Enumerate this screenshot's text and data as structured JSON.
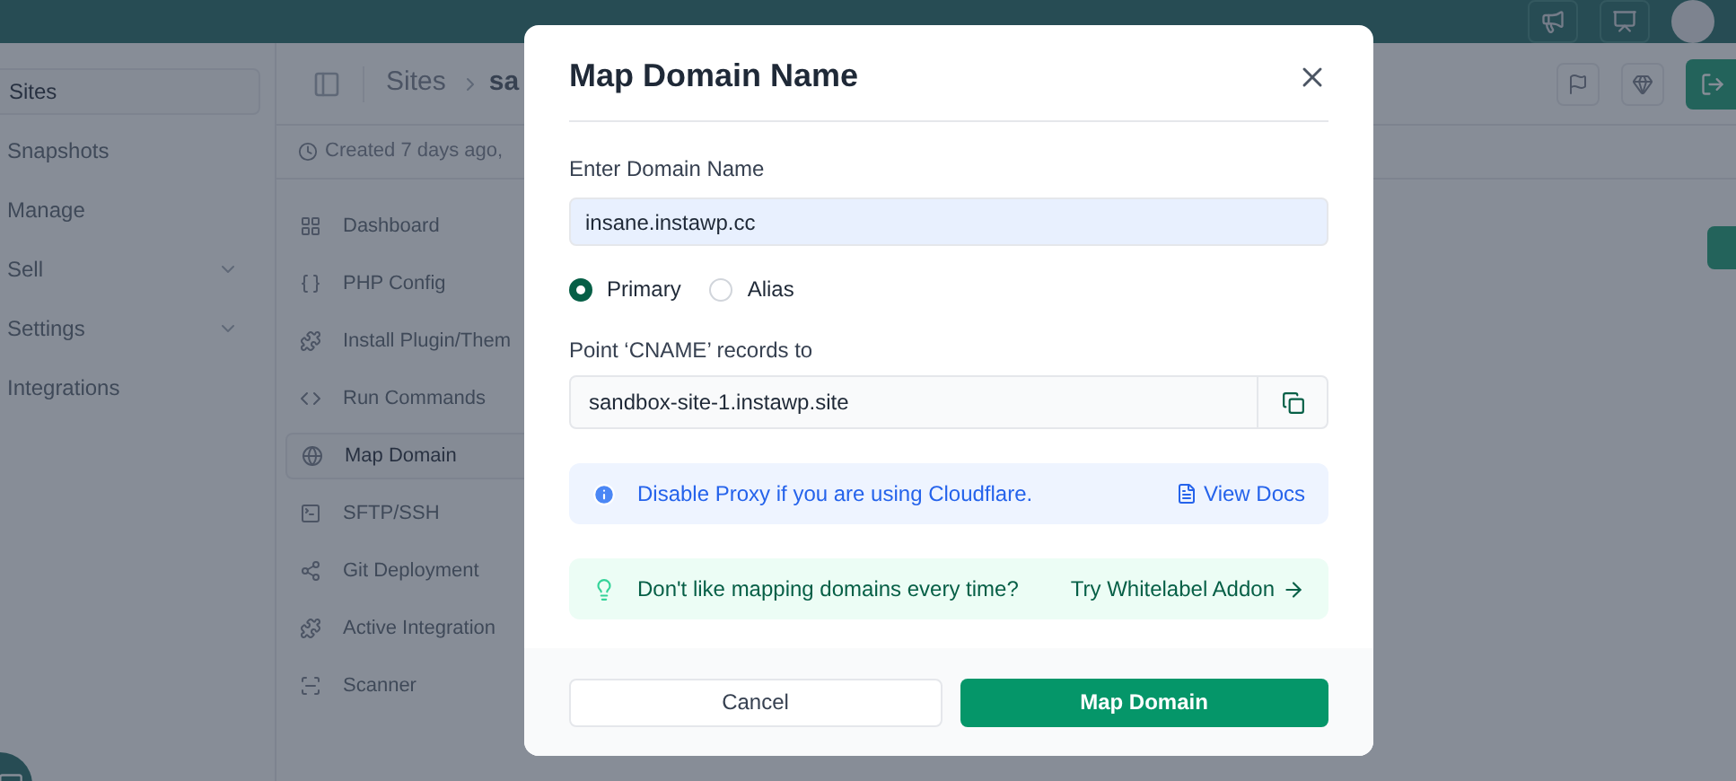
{
  "sidebar": {
    "items": [
      {
        "label": "Sites",
        "selected": true,
        "kind": "link"
      },
      {
        "label": "Snapshots",
        "selected": false,
        "kind": "link"
      },
      {
        "label": "Manage",
        "selected": false,
        "kind": "link"
      },
      {
        "label": "Sell",
        "selected": false,
        "kind": "group"
      },
      {
        "label": "Settings",
        "selected": false,
        "kind": "group"
      },
      {
        "label": "Integrations",
        "selected": false,
        "kind": "link"
      }
    ]
  },
  "header": {
    "breadcrumb": [
      "Sites",
      "sa"
    ]
  },
  "site_info": {
    "created": "Created 7 days ago,"
  },
  "site_nav": {
    "items": [
      {
        "label": "Dashboard",
        "selected": false
      },
      {
        "label": "PHP Config",
        "selected": false
      },
      {
        "label": "Install Plugin/Them",
        "selected": false
      },
      {
        "label": "Run Commands",
        "selected": false
      },
      {
        "label": "Map Domain",
        "selected": true
      },
      {
        "label": "SFTP/SSH",
        "selected": false
      },
      {
        "label": "Git Deployment",
        "selected": false
      },
      {
        "label": "Active Integration",
        "selected": false
      },
      {
        "label": "Scanner",
        "selected": false
      }
    ]
  },
  "modal": {
    "title": "Map Domain Name",
    "domain_label": "Enter Domain Name",
    "domain_value": "insane.instawp.cc",
    "type_options": [
      {
        "label": "Primary",
        "selected": true
      },
      {
        "label": "Alias",
        "selected": false
      }
    ],
    "cname_label": "Point ‘CNAME’ records to",
    "cname_value": "sandbox-site-1.instawp.site",
    "info_notice": {
      "text": "Disable Proxy if you are using Cloudflare.",
      "link": "View Docs"
    },
    "tip_notice": {
      "text": "Don't like mapping domains every time?",
      "link": "Try Whitelabel Addon"
    },
    "buttons": [
      {
        "label": "Cancel",
        "kind": "secondary"
      },
      {
        "label": "Map Domain",
        "kind": "primary"
      }
    ]
  }
}
